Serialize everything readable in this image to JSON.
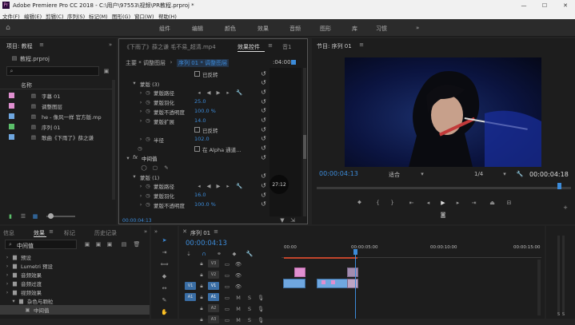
{
  "window": {
    "title": "Adobe Premiere Pro CC 2018 - C:\\用户\\97553\\视频\\PR教程.prproj *",
    "controls": {
      "minimize": "—",
      "maximize": "☐",
      "close": "✕"
    }
  },
  "menu": [
    "文件(F)",
    "编辑(E)",
    "剪辑(C)",
    "序列(S)",
    "标记(M)",
    "图形(G)",
    "窗口(W)",
    "帮助(H)"
  ],
  "workspaces": [
    "组件",
    "编辑",
    "颜色",
    "效果",
    "音频",
    "图形",
    "库",
    "习惯"
  ],
  "workspace_more": "»",
  "project": {
    "title": "项目: 教程",
    "file": "教程.prproj",
    "column_name": "名称",
    "items": [
      {
        "name": "字幕 01",
        "color": "#e08fd0"
      },
      {
        "name": "调整图层",
        "color": "#e08fd0"
      },
      {
        "name": "he - 像风一样 官方版.mp",
        "color": "#6fa7e0"
      },
      {
        "name": "序列 01",
        "color": "#5bbf6a"
      },
      {
        "name": "歌曲《下雨了》薛之谦",
        "color": "#6fa7e0"
      }
    ]
  },
  "effect_controls": {
    "tab_source": "《下雨了》薛之谦 毛不易_超清.mp4",
    "tab_effects": "效果控件",
    "tab_audio": "音1",
    "master": "主要 * 调整图层",
    "clip": "序列 01 * 调整图层",
    "time_marker": ":04:00",
    "rows": [
      {
        "type": "check",
        "label": "已反转"
      },
      {
        "type": "section",
        "label": "蒙版 (3)"
      },
      {
        "type": "prop",
        "label": "蒙版路径"
      },
      {
        "type": "prop",
        "label": "蒙版羽化",
        "value": "25.0"
      },
      {
        "type": "prop",
        "label": "蒙版不透明度",
        "value": "100.0 %"
      },
      {
        "type": "prop",
        "label": "蒙版扩展",
        "value": "14.0"
      },
      {
        "type": "check",
        "label": "已反转"
      },
      {
        "type": "prop",
        "label": "半径",
        "value": "102.0"
      },
      {
        "type": "checkalpha",
        "label": "在 Alpha 通道..."
      },
      {
        "type": "fx",
        "label": "中间值"
      },
      {
        "type": "shapes",
        "label": ""
      },
      {
        "type": "section",
        "label": "蒙版 (1)"
      },
      {
        "type": "prop",
        "label": "蒙版路径"
      },
      {
        "type": "prop",
        "label": "蒙版羽化",
        "value": "16.0"
      },
      {
        "type": "prop",
        "label": "蒙版不透明度",
        "value": "100.0 %"
      }
    ],
    "timecode": "00:00:04:13",
    "badge": "27:12"
  },
  "program": {
    "title": "节目: 序列 01",
    "timecode": "00:00:04:13",
    "fit": "适合",
    "quality": "1/4",
    "duration": "00:00:04:18"
  },
  "effects_panel": {
    "tabs": [
      "信息",
      "效果",
      "标记",
      "历史记录"
    ],
    "search": "中间值",
    "tree": [
      {
        "label": "预设",
        "indent": 0
      },
      {
        "label": "Lumetri 预设",
        "indent": 0
      },
      {
        "label": "音频效果",
        "indent": 0
      },
      {
        "label": "音频过渡",
        "indent": 0
      },
      {
        "label": "视频效果",
        "indent": 0
      },
      {
        "label": "杂色与颗粒",
        "indent": 1
      },
      {
        "label": "中间值",
        "indent": 2
      }
    ]
  },
  "timeline": {
    "title": "序列 01",
    "timecode": "00:00:04:13",
    "ruler": [
      "00:00",
      "00:00:05:00",
      "00:00:10:00",
      "00:00:15:00"
    ],
    "tracks": [
      {
        "name": "V3",
        "kind": "video"
      },
      {
        "name": "V2",
        "kind": "video"
      },
      {
        "name": "V1",
        "kind": "video",
        "source": "V1"
      },
      {
        "name": "A1",
        "kind": "audio",
        "source": "A1"
      },
      {
        "name": "A2",
        "kind": "audio"
      },
      {
        "name": "A3",
        "kind": "audio"
      }
    ],
    "track_btn_m": "M",
    "track_btn_s": "S"
  },
  "colors": {
    "accent": "#3c8bd9",
    "label_pink": "#e08fd0",
    "label_blue": "#6fa7e0",
    "label_green": "#5bbf6a"
  }
}
